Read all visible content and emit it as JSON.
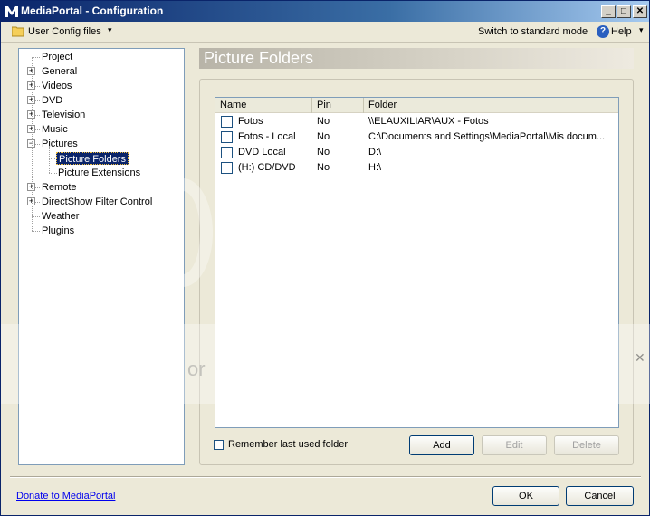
{
  "window": {
    "title": "MediaPortal - Configuration",
    "minimize_glyph": "_",
    "maximize_glyph": "□",
    "close_glyph": "✕"
  },
  "toolbar": {
    "user_config": "User Config files",
    "dropdown_glyph": "▾",
    "switch_mode": "Switch to standard mode",
    "help_glyph": "?",
    "help_label": "Help",
    "help_dropdown_glyph": "▾"
  },
  "tree": {
    "items": [
      {
        "label": "Project",
        "expandable": false
      },
      {
        "label": "General",
        "expandable": true,
        "state": "+"
      },
      {
        "label": "Videos",
        "expandable": true,
        "state": "+"
      },
      {
        "label": "DVD",
        "expandable": true,
        "state": "+"
      },
      {
        "label": "Television",
        "expandable": true,
        "state": "+"
      },
      {
        "label": "Music",
        "expandable": true,
        "state": "+"
      },
      {
        "label": "Pictures",
        "expandable": true,
        "state": "−"
      },
      {
        "label": "Picture Folders",
        "child": true,
        "selected": true
      },
      {
        "label": "Picture Extensions",
        "child": true
      },
      {
        "label": "Remote",
        "expandable": true,
        "state": "+"
      },
      {
        "label": "DirectShow Filter Control",
        "expandable": true,
        "state": "+"
      },
      {
        "label": "Weather",
        "expandable": false
      },
      {
        "label": "Plugins",
        "expandable": false
      }
    ]
  },
  "section": {
    "title": "Picture Folders"
  },
  "list": {
    "columns": [
      "Name",
      "Pin",
      "Folder"
    ],
    "rows": [
      {
        "name": "Fotos",
        "pin": "No",
        "folder": "\\\\ELAUXILIAR\\AUX - Fotos"
      },
      {
        "name": "Fotos - Local",
        "pin": "No",
        "folder": "C:\\Documents and Settings\\MediaPortal\\Mis docum..."
      },
      {
        "name": "DVD Local",
        "pin": "No",
        "folder": "D:\\"
      },
      {
        "name": "(H:) CD/DVD",
        "pin": "No",
        "folder": "H:\\"
      }
    ]
  },
  "controls": {
    "remember_label": "Remember last used folder",
    "add_label": "Add",
    "edit_label": "Edit",
    "delete_label": "Delete"
  },
  "footer": {
    "donate_label": "Donate to MediaPortal",
    "ok_label": "OK",
    "cancel_label": "Cancel"
  },
  "watermark": {
    "text": "or",
    "close_glyph": "✕"
  }
}
